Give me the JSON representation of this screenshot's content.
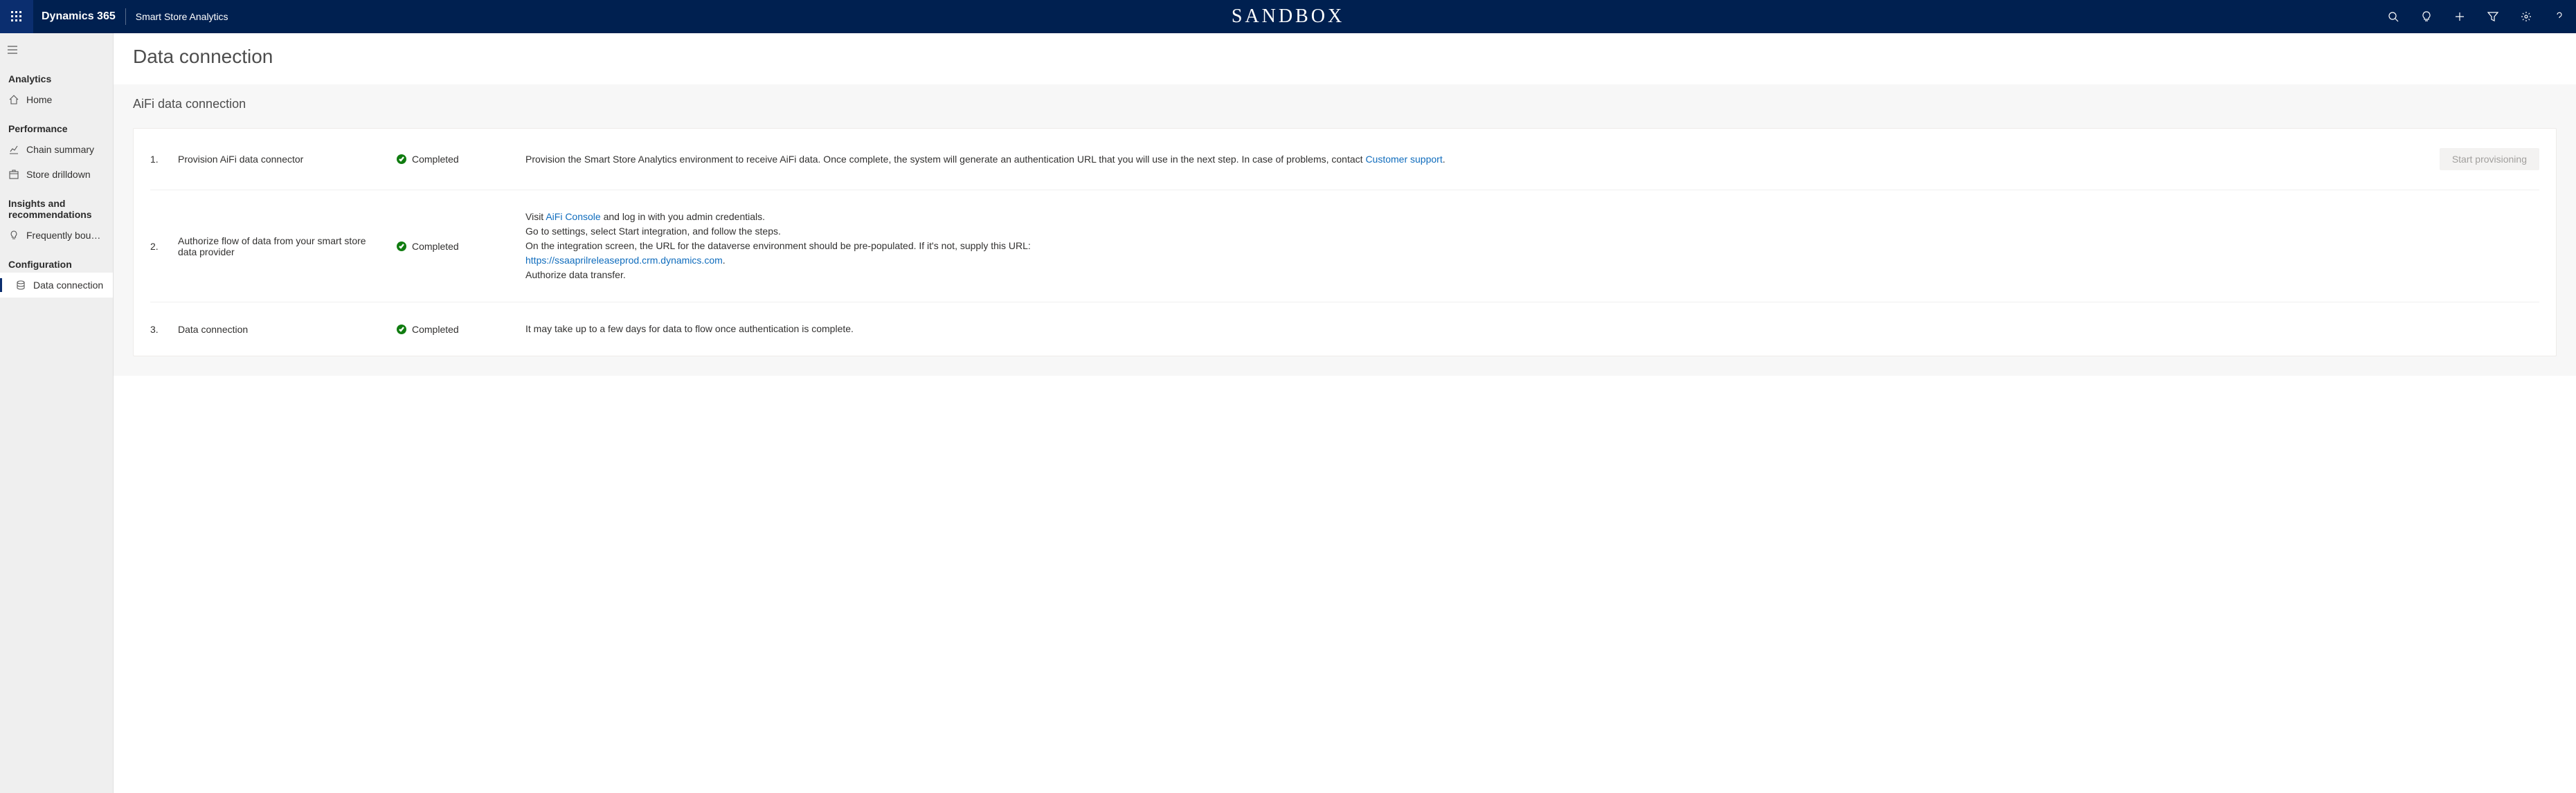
{
  "topbar": {
    "brand": "Dynamics 365",
    "app_name": "Smart Store Analytics",
    "env_label": "SANDBOX"
  },
  "sidebar": {
    "sections": [
      {
        "label": "Analytics",
        "items": [
          {
            "id": "home",
            "label": "Home"
          }
        ]
      },
      {
        "label": "Performance",
        "items": [
          {
            "id": "chain-summary",
            "label": "Chain summary"
          },
          {
            "id": "store-drilldown",
            "label": "Store drilldown"
          }
        ]
      },
      {
        "label": "Insights and recommendations",
        "items": [
          {
            "id": "freq-bought",
            "label": "Frequently bought t..."
          }
        ]
      },
      {
        "label": "Configuration",
        "items": [
          {
            "id": "data-connection",
            "label": "Data connection",
            "active": true
          }
        ]
      }
    ]
  },
  "page": {
    "title": "Data connection",
    "section_title": "AiFi data connection",
    "steps": [
      {
        "num": "1.",
        "name": "Provision AiFi data connector",
        "status": "Completed",
        "desc_pre": "Provision the Smart Store Analytics environment to receive AiFi data. Once complete, the system will generate an authentication URL that you will use in the next step. In case of problems, contact ",
        "desc_link": "Customer support",
        "desc_post": ".",
        "action_label": "Start provisioning"
      },
      {
        "num": "2.",
        "name": "Authorize flow of data from your smart store data provider",
        "status": "Completed",
        "lines": {
          "l1_pre": "Visit ",
          "l1_link": "AiFi Console",
          "l1_post": " and log in with you admin credentials.",
          "l2": "Go to settings, select Start integration, and follow the steps.",
          "l3": "On the integration screen, the URL for the dataverse environment should be pre-populated. If it's not, supply this URL:",
          "l4_link": "https://ssaaprilreleaseprod.crm.dynamics.com",
          "l4_post": ".",
          "l5": "Authorize data transfer."
        }
      },
      {
        "num": "3.",
        "name": "Data connection",
        "status": "Completed",
        "desc": "It may take up to a few days for data to flow once authentication is complete."
      }
    ]
  }
}
